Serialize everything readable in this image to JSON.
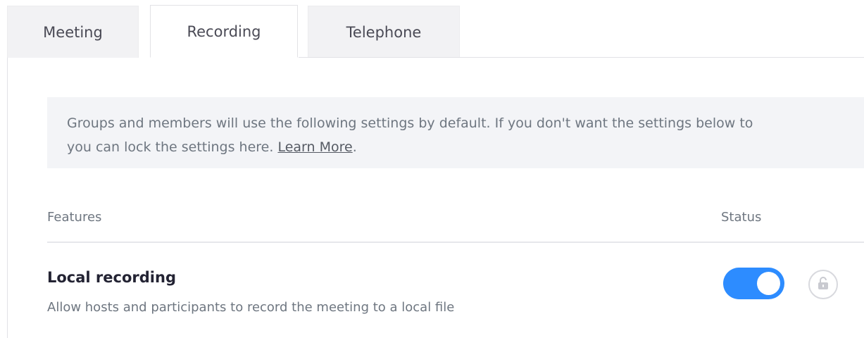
{
  "tabs": [
    {
      "label": "Meeting",
      "active": false
    },
    {
      "label": "Recording",
      "active": true
    },
    {
      "label": "Telephone",
      "active": false
    }
  ],
  "info": {
    "line1": "Groups and members will use the following settings by default. If you don't want the settings below to",
    "line2_prefix": "you can lock the settings here. ",
    "learn_more": "Learn More",
    "line2_suffix": "."
  },
  "table": {
    "col_features": "Features",
    "col_status": "Status"
  },
  "settings": [
    {
      "title": "Local recording",
      "description": "Allow hosts and participants to record the meeting to a local file",
      "enabled": true,
      "locked": false
    }
  ],
  "colors": {
    "accent": "#2d8cff",
    "tab_inactive_bg": "#f2f2f4",
    "info_bg": "#f3f4f7",
    "text_muted": "#6e7680",
    "text_dark": "#232333"
  },
  "icons": {
    "lock": "unlock-icon"
  }
}
